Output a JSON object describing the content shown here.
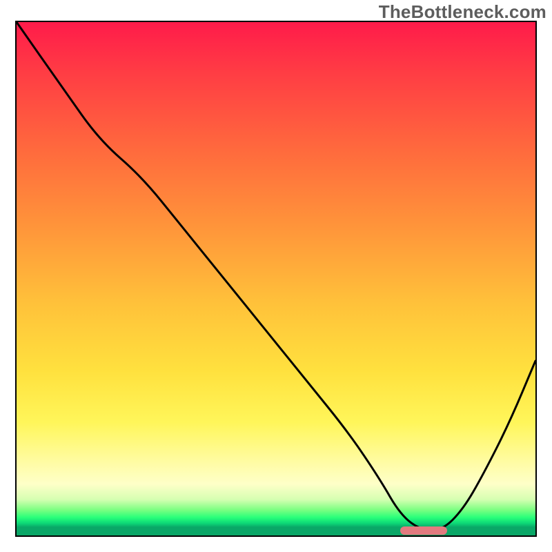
{
  "watermark": "TheBottleneck.com",
  "chart_data": {
    "type": "line",
    "title": "",
    "xlabel": "",
    "ylabel": "",
    "xlim": [
      0,
      100
    ],
    "ylim": [
      0,
      100
    ],
    "grid": false,
    "legend": false,
    "description": "Bottleneck curve over a red-to-green vertical gradient. Curve falls from top-left, bends, keeps falling to a minimum around x≈78 then rises toward the right edge. A short salmon bar marks the optimal (near-zero bottleneck) region.",
    "series": [
      {
        "name": "bottleneck-curve",
        "x": [
          0,
          9,
          16,
          24,
          32,
          40,
          48,
          56,
          64,
          70,
          74,
          78,
          82,
          86,
          90,
          95,
          100
        ],
        "values": [
          100,
          87,
          77,
          70,
          60,
          50,
          40,
          30,
          20,
          11,
          4,
          1,
          1,
          5,
          12,
          22,
          34
        ]
      }
    ],
    "optimal_band": {
      "x_start": 74,
      "x_end": 83,
      "y": 1
    },
    "gradient_colors": {
      "top": "#ff1b4a",
      "mid_high": "#ff953a",
      "mid": "#ffe13e",
      "mid_low": "#fffca6",
      "low": "#29ff7a",
      "bottom": "#0aa767"
    }
  }
}
